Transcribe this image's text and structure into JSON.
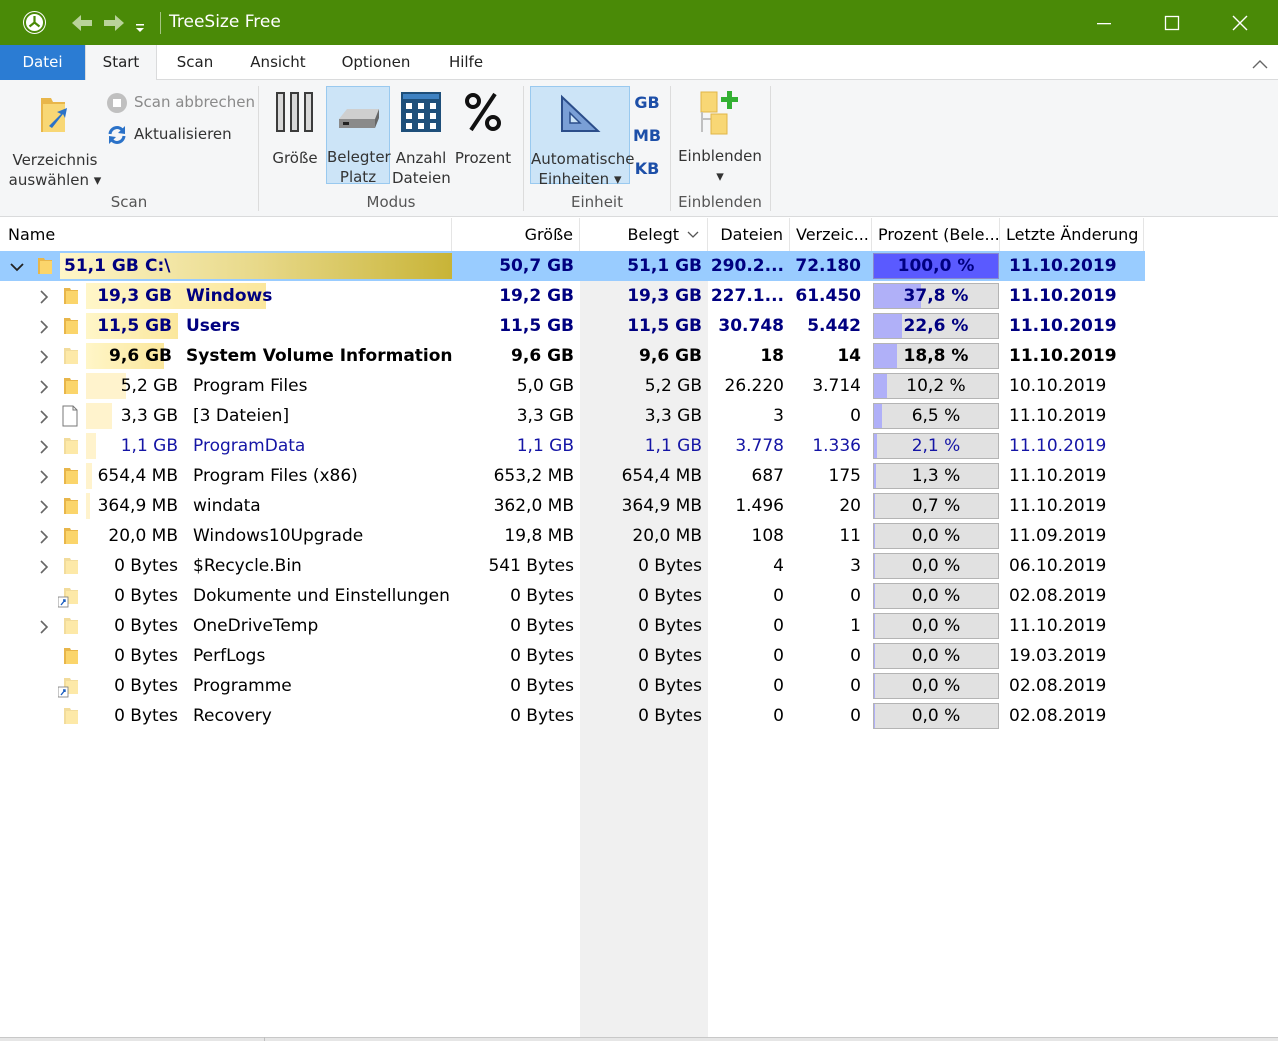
{
  "window": {
    "title": "TreeSize Free"
  },
  "tabs": [
    {
      "label": "Datei"
    },
    {
      "label": "Start"
    },
    {
      "label": "Scan"
    },
    {
      "label": "Ansicht"
    },
    {
      "label": "Optionen"
    },
    {
      "label": "Hilfe"
    }
  ],
  "ribbon": {
    "select_dir": {
      "line1": "Verzeichnis",
      "line2": "auswählen"
    },
    "scan_abort": "Scan abbrechen",
    "refresh": "Aktualisieren",
    "group_scan": "Scan",
    "size": "Größe",
    "occupied": {
      "line1": "Belegter",
      "line2": "Platz"
    },
    "file_count": {
      "line1": "Anzahl",
      "line2": "Dateien"
    },
    "percent": "Prozent",
    "group_mode": "Modus",
    "auto_units": {
      "line1": "Automatische",
      "line2": "Einheiten"
    },
    "unit_gb": "GB",
    "unit_mb": "MB",
    "unit_kb": "KB",
    "group_unit": "Einheit",
    "show": "Einblenden",
    "group_show": "Einblenden"
  },
  "columns": {
    "name": "Name",
    "size": "Größe",
    "occupied": "Belegt",
    "files": "Dateien",
    "dirs": "Verzeic...",
    "percent": "Prozent (Bele...",
    "modified": "Letzte Änderung"
  },
  "root": {
    "size_label": "51,1 GB",
    "name": "C:\\",
    "size": "50,7 GB",
    "occupied": "51,1 GB",
    "files": "290.2...",
    "dirs": "72.180",
    "percent": "100,0 %",
    "percent_value": 100,
    "modified": "11.10.2019"
  },
  "rows": [
    {
      "size_label": "19,3 GB",
      "name": "Windows",
      "size": "19,2 GB",
      "occupied": "19,3 GB",
      "files": "227.1...",
      "dirs": "61.450",
      "percent": "37,8 %",
      "percent_value": 37.8,
      "modified": "11.10.2019"
    },
    {
      "size_label": "11,5 GB",
      "name": "Users",
      "size": "11,5 GB",
      "occupied": "11,5 GB",
      "files": "30.748",
      "dirs": "5.442",
      "percent": "22,6 %",
      "percent_value": 22.6,
      "modified": "11.10.2019"
    },
    {
      "size_label": "9,6 GB",
      "name": "System Volume Information",
      "size": "9,6 GB",
      "occupied": "9,6 GB",
      "files": "18",
      "dirs": "14",
      "percent": "18,8 %",
      "percent_value": 18.8,
      "modified": "11.10.2019"
    },
    {
      "size_label": "5,2 GB",
      "name": "Program Files",
      "size": "5,0 GB",
      "occupied": "5,2 GB",
      "files": "26.220",
      "dirs": "3.714",
      "percent": "10,2 %",
      "percent_value": 10.2,
      "modified": "10.10.2019"
    },
    {
      "size_label": "3,3 GB",
      "name": "[3 Dateien]",
      "size": "3,3 GB",
      "occupied": "3,3 GB",
      "files": "3",
      "dirs": "0",
      "percent": "6,5 %",
      "percent_value": 6.5,
      "modified": "11.10.2019"
    },
    {
      "size_label": "1,1 GB",
      "name": "ProgramData",
      "size": "1,1 GB",
      "occupied": "1,1 GB",
      "files": "3.778",
      "dirs": "1.336",
      "percent": "2,1 %",
      "percent_value": 2.1,
      "modified": "11.10.2019"
    },
    {
      "size_label": "654,4 MB",
      "name": "Program Files (x86)",
      "size": "653,2 MB",
      "occupied": "654,4 MB",
      "files": "687",
      "dirs": "175",
      "percent": "1,3 %",
      "percent_value": 1.3,
      "modified": "11.10.2019"
    },
    {
      "size_label": "364,9 MB",
      "name": "windata",
      "size": "362,0 MB",
      "occupied": "364,9 MB",
      "files": "1.496",
      "dirs": "20",
      "percent": "0,7 %",
      "percent_value": 0.7,
      "modified": "11.10.2019"
    },
    {
      "size_label": "20,0 MB",
      "name": "Windows10Upgrade",
      "size": "19,8 MB",
      "occupied": "20,0 MB",
      "files": "108",
      "dirs": "11",
      "percent": "0,0 %",
      "percent_value": 0,
      "modified": "11.09.2019"
    },
    {
      "size_label": "0 Bytes",
      "name": "$Recycle.Bin",
      "size": "541 Bytes",
      "occupied": "0 Bytes",
      "files": "4",
      "dirs": "3",
      "percent": "0,0 %",
      "percent_value": 0,
      "modified": "06.10.2019"
    },
    {
      "size_label": "0 Bytes",
      "name": "Dokumente und Einstellungen",
      "size": "0 Bytes",
      "occupied": "0 Bytes",
      "files": "0",
      "dirs": "0",
      "percent": "0,0 %",
      "percent_value": 0,
      "modified": "02.08.2019"
    },
    {
      "size_label": "0 Bytes",
      "name": "OneDriveTemp",
      "size": "0 Bytes",
      "occupied": "0 Bytes",
      "files": "0",
      "dirs": "1",
      "percent": "0,0 %",
      "percent_value": 0,
      "modified": "11.10.2019"
    },
    {
      "size_label": "0 Bytes",
      "name": "PerfLogs",
      "size": "0 Bytes",
      "occupied": "0 Bytes",
      "files": "0",
      "dirs": "0",
      "percent": "0,0 %",
      "percent_value": 0,
      "modified": "19.03.2019"
    },
    {
      "size_label": "0 Bytes",
      "name": "Programme",
      "size": "0 Bytes",
      "occupied": "0 Bytes",
      "files": "0",
      "dirs": "0",
      "percent": "0,0 %",
      "percent_value": 0,
      "modified": "02.08.2019"
    },
    {
      "size_label": "0 Bytes",
      "name": "Recovery",
      "size": "0 Bytes",
      "occupied": "0 Bytes",
      "files": "0",
      "dirs": "0",
      "percent": "0,0 %",
      "percent_value": 0,
      "modified": "02.08.2019"
    }
  ]
}
